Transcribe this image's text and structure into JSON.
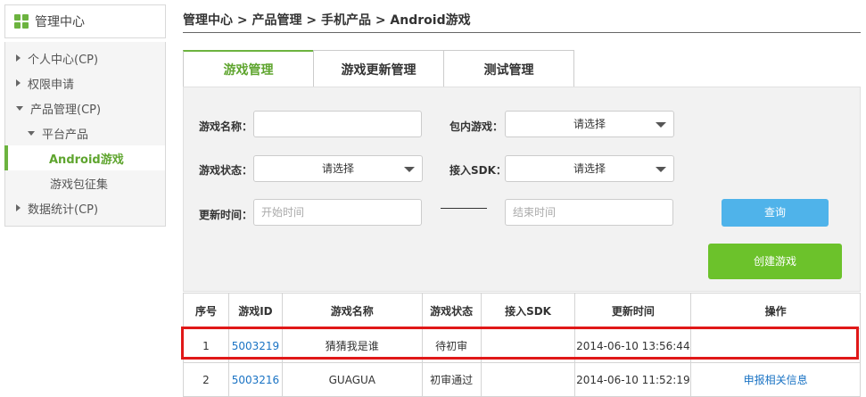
{
  "sidebar": {
    "title": "管理中心",
    "icon": "grid-icon",
    "items": [
      {
        "label": "个人中心(CP)",
        "arrow": "right"
      },
      {
        "label": "权限申请",
        "arrow": "right"
      },
      {
        "label": "产品管理(CP)",
        "arrow": "down"
      },
      {
        "label": "平台产品",
        "arrow": "down"
      },
      {
        "label": "Android游戏",
        "active": true
      },
      {
        "label": "游戏包征集"
      },
      {
        "label": "数据统计(CP)",
        "arrow": "right"
      }
    ]
  },
  "breadcrumb": "管理中心 > 产品管理 > 手机产品 > Android游戏",
  "tabs": [
    {
      "label": "游戏管理",
      "active": true
    },
    {
      "label": "游戏更新管理"
    },
    {
      "label": "测试管理"
    }
  ],
  "filters": {
    "game_name_label": "游戏名称：",
    "game_name_value": "",
    "bundled_label": "包内游戏：",
    "bundled_value": "请选择",
    "status_label": "游戏状态：",
    "status_value": "请选择",
    "sdk_label": "接入SDK：",
    "sdk_value": "请选择",
    "update_time_label": "更新时间：",
    "start_placeholder": "开始时间",
    "end_placeholder": "结束时间",
    "query_button": "查询",
    "create_button": "创建游戏"
  },
  "table": {
    "headers": [
      "序号",
      "游戏ID",
      "游戏名称",
      "游戏状态",
      "接入SDK",
      "更新时间",
      "操作"
    ],
    "rows": [
      {
        "index": "1",
        "id": "5003219",
        "name": "猜猜我是谁",
        "status": "待初审",
        "sdk": "",
        "updated": "2014-06-10 13:56:44",
        "action": ""
      },
      {
        "index": "2",
        "id": "5003216",
        "name": "GUAGUA",
        "status": "初审通过",
        "sdk": "",
        "updated": "2014-06-10 11:52:19",
        "action": "申报相关信息"
      }
    ]
  },
  "colors": {
    "accent_green": "#6cb33f",
    "query_blue": "#4fb3ea",
    "create_green": "#6cc22b",
    "highlight_red": "#e01818",
    "link_blue": "#1a73c4"
  }
}
